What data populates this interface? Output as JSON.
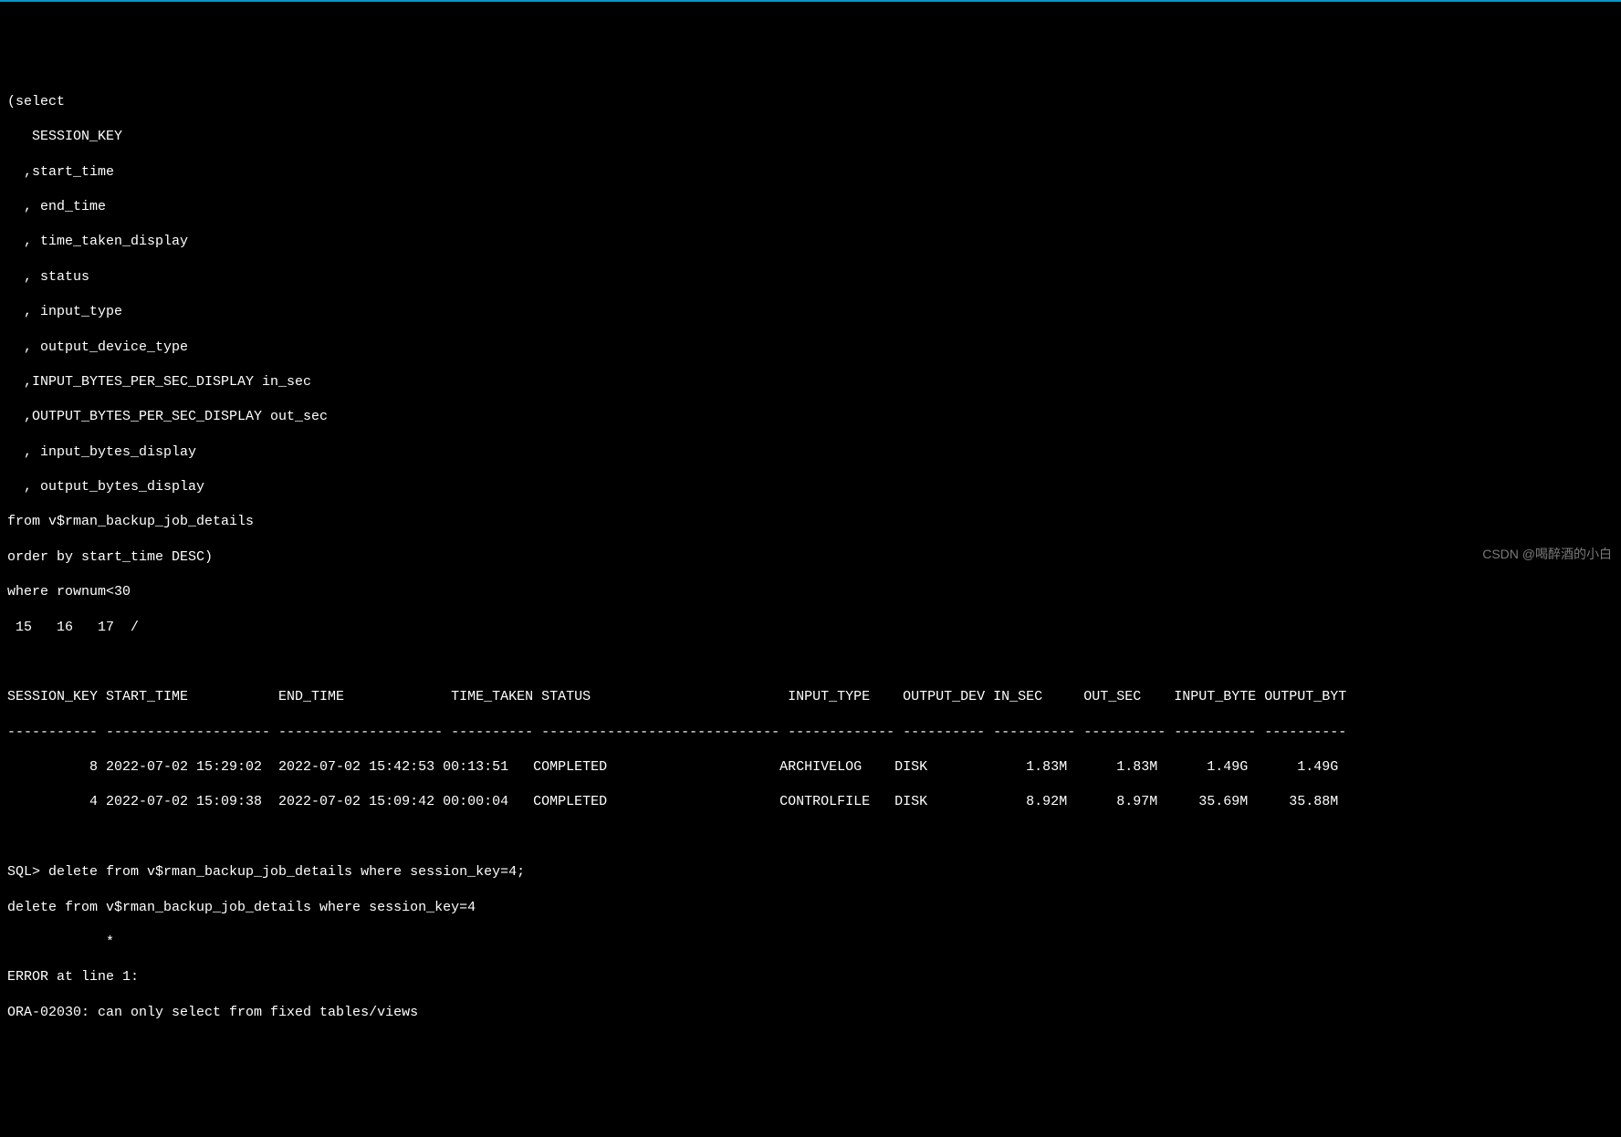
{
  "query": {
    "lines": [
      "(select",
      "   SESSION_KEY",
      "  ,start_time",
      "  , end_time",
      "  , time_taken_display",
      "  , status",
      "  , input_type",
      "  , output_device_type",
      "  ,INPUT_BYTES_PER_SEC_DISPLAY in_sec",
      "  ,OUTPUT_BYTES_PER_SEC_DISPLAY out_sec",
      "  , input_bytes_display",
      "  , output_bytes_display",
      "from v$rman_backup_job_details",
      "order by start_time DESC)",
      "where rownum<30",
      " 15   16   17  /"
    ]
  },
  "table": {
    "header": "SESSION_KEY START_TIME           END_TIME             TIME_TAKEN STATUS                        INPUT_TYPE    OUTPUT_DEV IN_SEC     OUT_SEC    INPUT_BYTE OUTPUT_BYT",
    "divider": "----------- -------------------- -------------------- ---------- ----------------------------- ------------- ---------- ---------- ---------- ---------- ----------",
    "rows": [
      "          8 2022-07-02 15:29:02  2022-07-02 15:42:53 00:13:51   COMPLETED                     ARCHIVELOG    DISK            1.83M      1.83M      1.49G      1.49G",
      "          4 2022-07-02 15:09:38  2022-07-02 15:09:42 00:00:04   COMPLETED                     CONTROLFILE   DISK            8.92M      8.97M     35.69M     35.88M"
    ]
  },
  "post": {
    "lines": [
      "SQL> delete from v$rman_backup_job_details where session_key=4;",
      "delete from v$rman_backup_job_details where session_key=4",
      "            *",
      "ERROR at line 1:",
      "ORA-02030: can only select from fixed tables/views"
    ]
  },
  "watermark": "CSDN @喝醉酒的小白"
}
